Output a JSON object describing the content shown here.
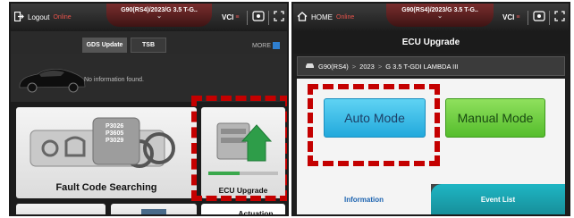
{
  "left_screen": {
    "header": {
      "logout_label": "Logout",
      "status": "Online",
      "vehicle": "G90(RS4)/2023/G 3.5 T-G..",
      "vci_label": "VCI"
    },
    "tabs": [
      {
        "label": "GDS Update"
      },
      {
        "label": "TSB"
      }
    ],
    "more_label": "MORE",
    "vehicle_info_message": "No information found.",
    "tiles": [
      {
        "label": "Fault Code Searching",
        "codes": [
          "P3026",
          "P3605",
          "P3029"
        ]
      },
      {
        "label": "ECU Upgrade"
      },
      {
        "label": "Actuation"
      }
    ]
  },
  "right_screen": {
    "header": {
      "home_label": "HOME",
      "status": "Online",
      "vehicle": "G90(RS4)/2023/G 3.5 T-G..",
      "vci_label": "VCI"
    },
    "title": "ECU Upgrade",
    "breadcrumb": [
      "G90(RS4)",
      "2023",
      "G 3.5 T-GDI LAMBDA III"
    ],
    "buttons": {
      "auto_mode": "Auto Mode",
      "manual_mode": "Manual Mode"
    },
    "bottom_tabs": [
      {
        "label": "Information"
      },
      {
        "label": "Event List"
      }
    ]
  },
  "colors": {
    "highlight": "#c40000",
    "online_status": "#e8534b",
    "auto_mode": "#22a9dc",
    "manual_mode": "#55bd2c",
    "active_tab_text": "#1c63b0",
    "event_tab": "#1fb6c4"
  },
  "icons": [
    "logout-icon",
    "home-icon",
    "vci-signal-icon",
    "device-icon",
    "fullscreen-icon",
    "car-icon"
  ]
}
